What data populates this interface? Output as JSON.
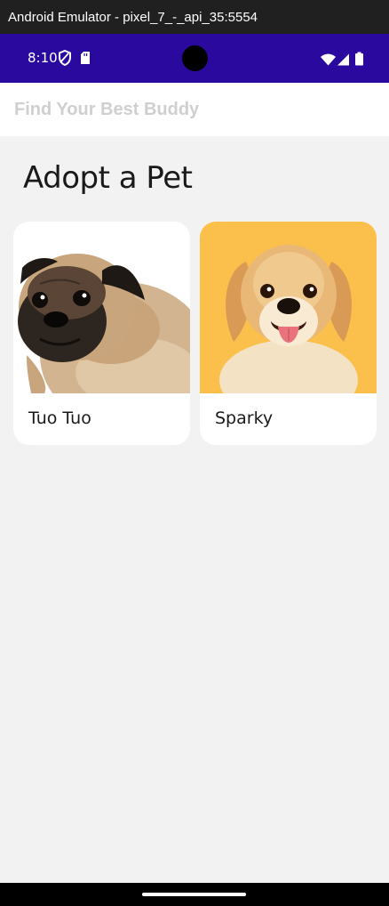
{
  "window": {
    "title": "Android Emulator - pixel_7_-_api_35:5554"
  },
  "status_bar": {
    "time": "8:10",
    "color": "#2a0a9e",
    "icons": [
      "shield-icon",
      "sd-card-icon",
      "wifi-icon",
      "signal-icon",
      "battery-icon"
    ]
  },
  "search": {
    "placeholder": "Find Your Best Buddy",
    "value": ""
  },
  "main": {
    "title": "Adopt a Pet",
    "pets": [
      {
        "name": "Tuo Tuo",
        "image": "pug-photo",
        "bg": "#ffffff"
      },
      {
        "name": "Sparky",
        "image": "golden-retriever-puppy-photo",
        "bg": "#fbbf4c"
      }
    ]
  }
}
